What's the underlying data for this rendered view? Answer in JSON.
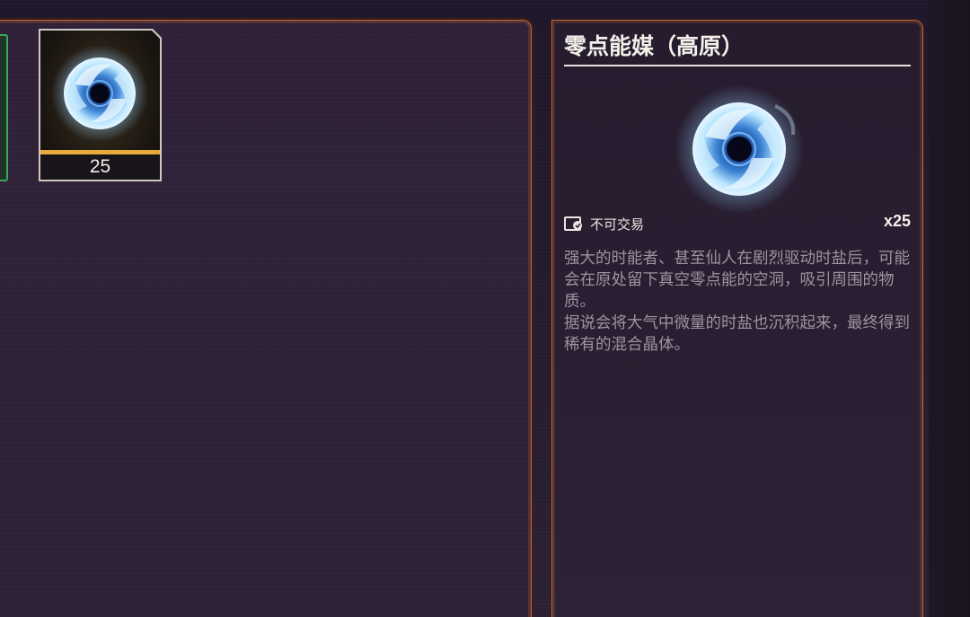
{
  "inventory": {
    "slot": {
      "icon": "zero-point-catalyst-orb",
      "count": "25",
      "rarity_color": "#e8a93d"
    }
  },
  "detail": {
    "title": "零点能媒（高原）",
    "icon": "zero-point-catalyst-orb",
    "tradeable_icon": "no-trade-icon",
    "tradeable_label": "不可交易",
    "quantity": "x25",
    "description_1": "强大的时能者、甚至仙人在剧烈驱动时盐后，可能会在原处留下真空零点能的空洞，吸引周围的物质。",
    "description_2": "据说会将大气中微量的时盐也沉积起来，最终得到稀有的混合晶体。"
  },
  "colors": {
    "panel_border": "#c86a2c",
    "selected_border": "#3fa45c"
  }
}
